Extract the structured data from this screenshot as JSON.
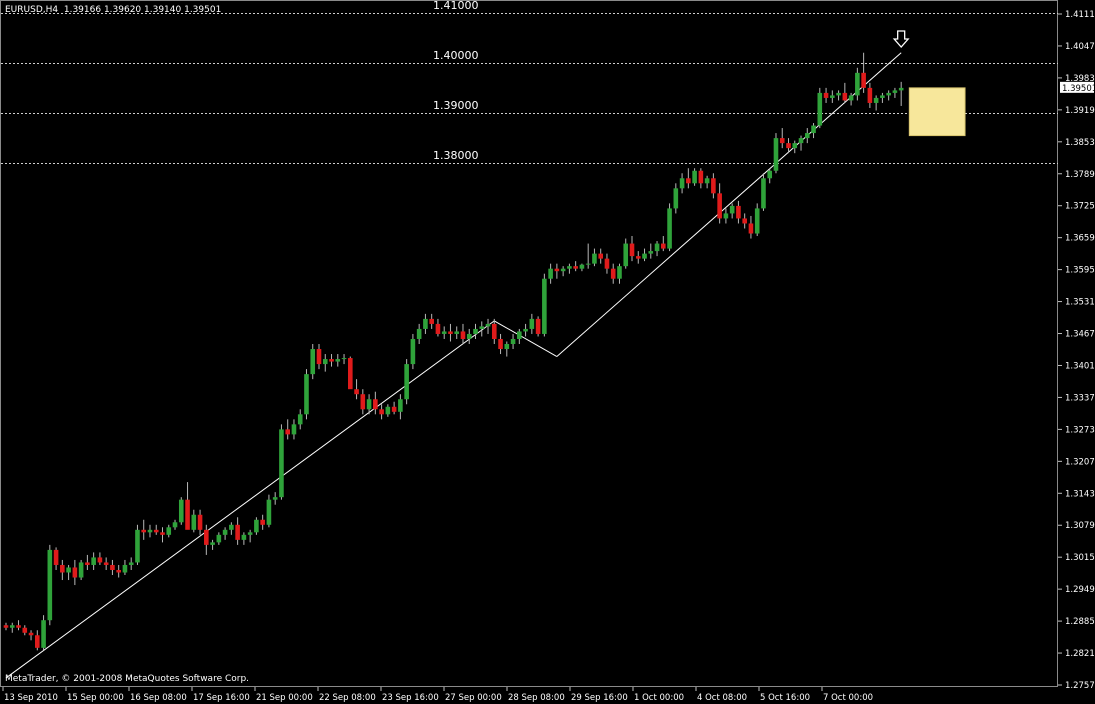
{
  "header": {
    "symbol": "EURUSD,H4",
    "ohlc": "1.39166 1.39620 1.39140 1.39501"
  },
  "copyright": "MetaTrader, © 2001-2008 MetaQuotes Software Corp.",
  "chart_data": {
    "type": "candlestick",
    "symbol": "EURUSD",
    "timeframe": "H4",
    "current_price": "1.39501",
    "y_ticks": [
      "1.41110",
      "1.40470",
      "1.39830",
      "1.39190",
      "1.38530",
      "1.37890",
      "1.37250",
      "1.36590",
      "1.35950",
      "1.35310",
      "1.34670",
      "1.34010",
      "1.33370",
      "1.32730",
      "1.32070",
      "1.31430",
      "1.30790",
      "1.30150",
      "1.29490",
      "1.28850",
      "1.28210",
      "1.27570"
    ],
    "x_ticks": [
      "13 Sep 2010",
      "15 Sep 00:00",
      "16 Sep 08:00",
      "17 Sep 16:00",
      "21 Sep 00:00",
      "22 Sep 08:00",
      "23 Sep 16:00",
      "27 Sep 00:00",
      "28 Sep 08:00",
      "29 Sep 16:00",
      "1 Oct 00:00",
      "4 Oct 08:00",
      "5 Oct 16:00",
      "7 Oct 00:00"
    ],
    "ylim": [
      1.2757,
      1.4125
    ],
    "horizontal_levels": [
      {
        "price": 1.41,
        "label": "1.41000"
      },
      {
        "price": 1.4,
        "label": "1.40000"
      },
      {
        "price": 1.39,
        "label": "1.39000"
      },
      {
        "price": 1.38,
        "label": "1.38000"
      }
    ],
    "trend_lines": [
      [
        [
          0,
          1.2775
        ],
        [
          78,
          1.3486
        ]
      ],
      [
        [
          78,
          1.3486
        ],
        [
          88,
          1.3415
        ]
      ],
      [
        [
          88,
          1.3415
        ],
        [
          143,
          1.402
        ]
      ]
    ],
    "highlight_box": {
      "bar_from": 144.3,
      "bar_to": 153.2,
      "price_low": 1.3855,
      "price_high": 1.395
    },
    "arrow_bar": 143,
    "candles": [
      [
        1.288,
        1.2885,
        1.287,
        1.2875
      ],
      [
        1.2875,
        1.2885,
        1.2865,
        1.288
      ],
      [
        1.288,
        1.289,
        1.287,
        1.2875
      ],
      [
        1.2875,
        1.288,
        1.286,
        1.2865
      ],
      [
        1.2865,
        1.287,
        1.285,
        1.286
      ],
      [
        1.286,
        1.287,
        1.283,
        1.2835
      ],
      [
        1.2835,
        1.29,
        1.283,
        1.289
      ],
      [
        1.289,
        1.304,
        1.288,
        1.303
      ],
      [
        1.303,
        1.3035,
        1.299,
        1.3
      ],
      [
        1.3,
        1.301,
        1.297,
        1.2985
      ],
      [
        1.2985,
        1.3,
        1.297,
        1.2995
      ],
      [
        1.2995,
        1.301,
        1.296,
        1.2975
      ],
      [
        1.2975,
        1.301,
        1.297,
        1.3005
      ],
      [
        1.3005,
        1.302,
        1.299,
        1.3
      ],
      [
        1.3,
        1.3025,
        1.299,
        1.3015
      ],
      [
        1.3015,
        1.3025,
        1.3,
        1.3005
      ],
      [
        1.3005,
        1.3015,
        1.299,
        1.3
      ],
      [
        1.3,
        1.301,
        1.298,
        1.299
      ],
      [
        1.299,
        1.3,
        1.2975,
        1.2985
      ],
      [
        1.2985,
        1.301,
        1.298,
        1.3
      ],
      [
        1.3,
        1.3015,
        1.299,
        1.3005
      ],
      [
        1.3005,
        1.308,
        1.3,
        1.307
      ],
      [
        1.307,
        1.309,
        1.305,
        1.3065
      ],
      [
        1.3065,
        1.308,
        1.3055,
        1.307
      ],
      [
        1.307,
        1.308,
        1.306,
        1.3065
      ],
      [
        1.3065,
        1.3075,
        1.3045,
        1.306
      ],
      [
        1.306,
        1.308,
        1.3055,
        1.3075
      ],
      [
        1.3075,
        1.309,
        1.307,
        1.3085
      ],
      [
        1.3085,
        1.3135,
        1.308,
        1.313
      ],
      [
        1.313,
        1.3165,
        1.312,
        1.307
      ],
      [
        1.307,
        1.311,
        1.3065,
        1.31
      ],
      [
        1.31,
        1.311,
        1.306,
        1.307
      ],
      [
        1.307,
        1.308,
        1.302,
        1.304
      ],
      [
        1.304,
        1.305,
        1.303,
        1.3045
      ],
      [
        1.3045,
        1.3065,
        1.304,
        1.306
      ],
      [
        1.306,
        1.3075,
        1.305,
        1.307
      ],
      [
        1.307,
        1.3085,
        1.306,
        1.308
      ],
      [
        1.308,
        1.3095,
        1.304,
        1.305
      ],
      [
        1.305,
        1.3065,
        1.304,
        1.306
      ],
      [
        1.306,
        1.307,
        1.3045,
        1.3065
      ],
      [
        1.3065,
        1.3095,
        1.306,
        1.309
      ],
      [
        1.309,
        1.31,
        1.307,
        1.308
      ],
      [
        1.308,
        1.314,
        1.3075,
        1.313
      ],
      [
        1.313,
        1.3145,
        1.312,
        1.3135
      ],
      [
        1.3135,
        1.328,
        1.313,
        1.327
      ],
      [
        1.327,
        1.329,
        1.325,
        1.326
      ],
      [
        1.326,
        1.329,
        1.325,
        1.328
      ],
      [
        1.328,
        1.331,
        1.327,
        1.33
      ],
      [
        1.33,
        1.339,
        1.329,
        1.338
      ],
      [
        1.338,
        1.344,
        1.337,
        1.343
      ],
      [
        1.343,
        1.344,
        1.339,
        1.34
      ],
      [
        1.34,
        1.342,
        1.3385,
        1.341
      ],
      [
        1.341,
        1.342,
        1.3395,
        1.3405
      ],
      [
        1.3405,
        1.342,
        1.3395,
        1.341
      ],
      [
        1.341,
        1.342,
        1.34,
        1.3412
      ],
      [
        1.3412,
        1.3415,
        1.339,
        1.335
      ],
      [
        1.335,
        1.337,
        1.333,
        1.334
      ],
      [
        1.334,
        1.335,
        1.33,
        1.331
      ],
      [
        1.331,
        1.334,
        1.33,
        1.333
      ],
      [
        1.333,
        1.3345,
        1.33,
        1.331
      ],
      [
        1.331,
        1.332,
        1.329,
        1.33
      ],
      [
        1.33,
        1.332,
        1.3295,
        1.3315
      ],
      [
        1.3315,
        1.3325,
        1.33,
        1.3305
      ],
      [
        1.3305,
        1.334,
        1.329,
        1.333
      ],
      [
        1.333,
        1.341,
        1.332,
        1.34
      ],
      [
        1.34,
        1.346,
        1.339,
        1.345
      ],
      [
        1.345,
        1.348,
        1.344,
        1.347
      ],
      [
        1.347,
        1.35,
        1.346,
        1.349
      ],
      [
        1.349,
        1.35,
        1.347,
        1.348
      ],
      [
        1.348,
        1.349,
        1.3455,
        1.346
      ],
      [
        1.346,
        1.3475,
        1.345,
        1.3465
      ],
      [
        1.3465,
        1.348,
        1.3445,
        1.346
      ],
      [
        1.346,
        1.3475,
        1.345,
        1.3465
      ],
      [
        1.3465,
        1.348,
        1.344,
        1.345
      ],
      [
        1.345,
        1.347,
        1.344,
        1.346
      ],
      [
        1.346,
        1.348,
        1.345,
        1.347
      ],
      [
        1.347,
        1.3485,
        1.3455,
        1.3475
      ],
      [
        1.3475,
        1.349,
        1.346,
        1.348
      ],
      [
        1.348,
        1.349,
        1.344,
        1.345
      ],
      [
        1.345,
        1.346,
        1.342,
        1.343
      ],
      [
        1.343,
        1.3445,
        1.3415,
        1.344
      ],
      [
        1.344,
        1.346,
        1.343,
        1.345
      ],
      [
        1.345,
        1.347,
        1.344,
        1.3465
      ],
      [
        1.3465,
        1.348,
        1.3455,
        1.347
      ],
      [
        1.347,
        1.35,
        1.346,
        1.349
      ],
      [
        1.349,
        1.3495,
        1.3455,
        1.346
      ],
      [
        1.346,
        1.358,
        1.3455,
        1.357
      ],
      [
        1.357,
        1.36,
        1.356,
        1.359
      ],
      [
        1.359,
        1.36,
        1.357,
        1.3585
      ],
      [
        1.3585,
        1.3595,
        1.3575,
        1.359
      ],
      [
        1.359,
        1.36,
        1.358,
        1.3595
      ],
      [
        1.3595,
        1.3605,
        1.3585,
        1.359
      ],
      [
        1.359,
        1.36,
        1.3585,
        1.3598
      ],
      [
        1.3598,
        1.364,
        1.359,
        1.36
      ],
      [
        1.36,
        1.363,
        1.3595,
        1.362
      ],
      [
        1.362,
        1.363,
        1.36,
        1.361
      ],
      [
        1.361,
        1.362,
        1.358,
        1.359
      ],
      [
        1.359,
        1.36,
        1.356,
        1.357
      ],
      [
        1.357,
        1.36,
        1.356,
        1.3595
      ],
      [
        1.3595,
        1.365,
        1.359,
        1.364
      ],
      [
        1.364,
        1.3655,
        1.3605,
        1.3615
      ],
      [
        1.3615,
        1.3625,
        1.36,
        1.361
      ],
      [
        1.361,
        1.363,
        1.3605,
        1.362
      ],
      [
        1.362,
        1.364,
        1.361,
        1.3625
      ],
      [
        1.3625,
        1.3645,
        1.3615,
        1.364
      ],
      [
        1.364,
        1.3655,
        1.3625,
        1.363
      ],
      [
        1.363,
        1.372,
        1.3625,
        1.371
      ],
      [
        1.371,
        1.376,
        1.37,
        1.375
      ],
      [
        1.375,
        1.378,
        1.374,
        1.377
      ],
      [
        1.377,
        1.379,
        1.375,
        1.376
      ],
      [
        1.376,
        1.379,
        1.3755,
        1.3785
      ],
      [
        1.3785,
        1.379,
        1.375,
        1.376
      ],
      [
        1.376,
        1.3775,
        1.375,
        1.377
      ],
      [
        1.377,
        1.378,
        1.373,
        1.374
      ],
      [
        1.374,
        1.376,
        1.368,
        1.369
      ],
      [
        1.369,
        1.371,
        1.368,
        1.37
      ],
      [
        1.37,
        1.372,
        1.369,
        1.3715
      ],
      [
        1.3715,
        1.3725,
        1.368,
        1.369
      ],
      [
        1.369,
        1.37,
        1.367,
        1.368
      ],
      [
        1.368,
        1.3695,
        1.365,
        1.366
      ],
      [
        1.366,
        1.372,
        1.3655,
        1.371
      ],
      [
        1.371,
        1.378,
        1.3705,
        1.377
      ],
      [
        1.377,
        1.379,
        1.376,
        1.3785
      ],
      [
        1.3785,
        1.386,
        1.378,
        1.385
      ],
      [
        1.385,
        1.387,
        1.383,
        1.384
      ],
      [
        1.384,
        1.385,
        1.382,
        1.383
      ],
      [
        1.383,
        1.3845,
        1.382,
        1.384
      ],
      [
        1.384,
        1.3855,
        1.3825,
        1.385
      ],
      [
        1.385,
        1.387,
        1.384,
        1.386
      ],
      [
        1.386,
        1.388,
        1.385,
        1.3875
      ],
      [
        1.3875,
        1.395,
        1.387,
        1.394
      ],
      [
        1.394,
        1.395,
        1.392,
        1.393
      ],
      [
        1.393,
        1.3945,
        1.392,
        1.3935
      ],
      [
        1.3935,
        1.3945,
        1.3925,
        1.394
      ],
      [
        1.394,
        1.396,
        1.392,
        1.3925
      ],
      [
        1.3925,
        1.394,
        1.3915,
        1.3935
      ],
      [
        1.3935,
        1.399,
        1.3925,
        1.398
      ],
      [
        1.398,
        1.402,
        1.394,
        1.395
      ],
      [
        1.395,
        1.396,
        1.391,
        1.392
      ],
      [
        1.392,
        1.3935,
        1.3905,
        1.393
      ],
      [
        1.393,
        1.394,
        1.392,
        1.3935
      ],
      [
        1.3935,
        1.3945,
        1.3925,
        1.394
      ],
      [
        1.394,
        1.395,
        1.393,
        1.3945
      ],
      [
        1.3945,
        1.3962,
        1.3914,
        1.395
      ]
    ]
  }
}
